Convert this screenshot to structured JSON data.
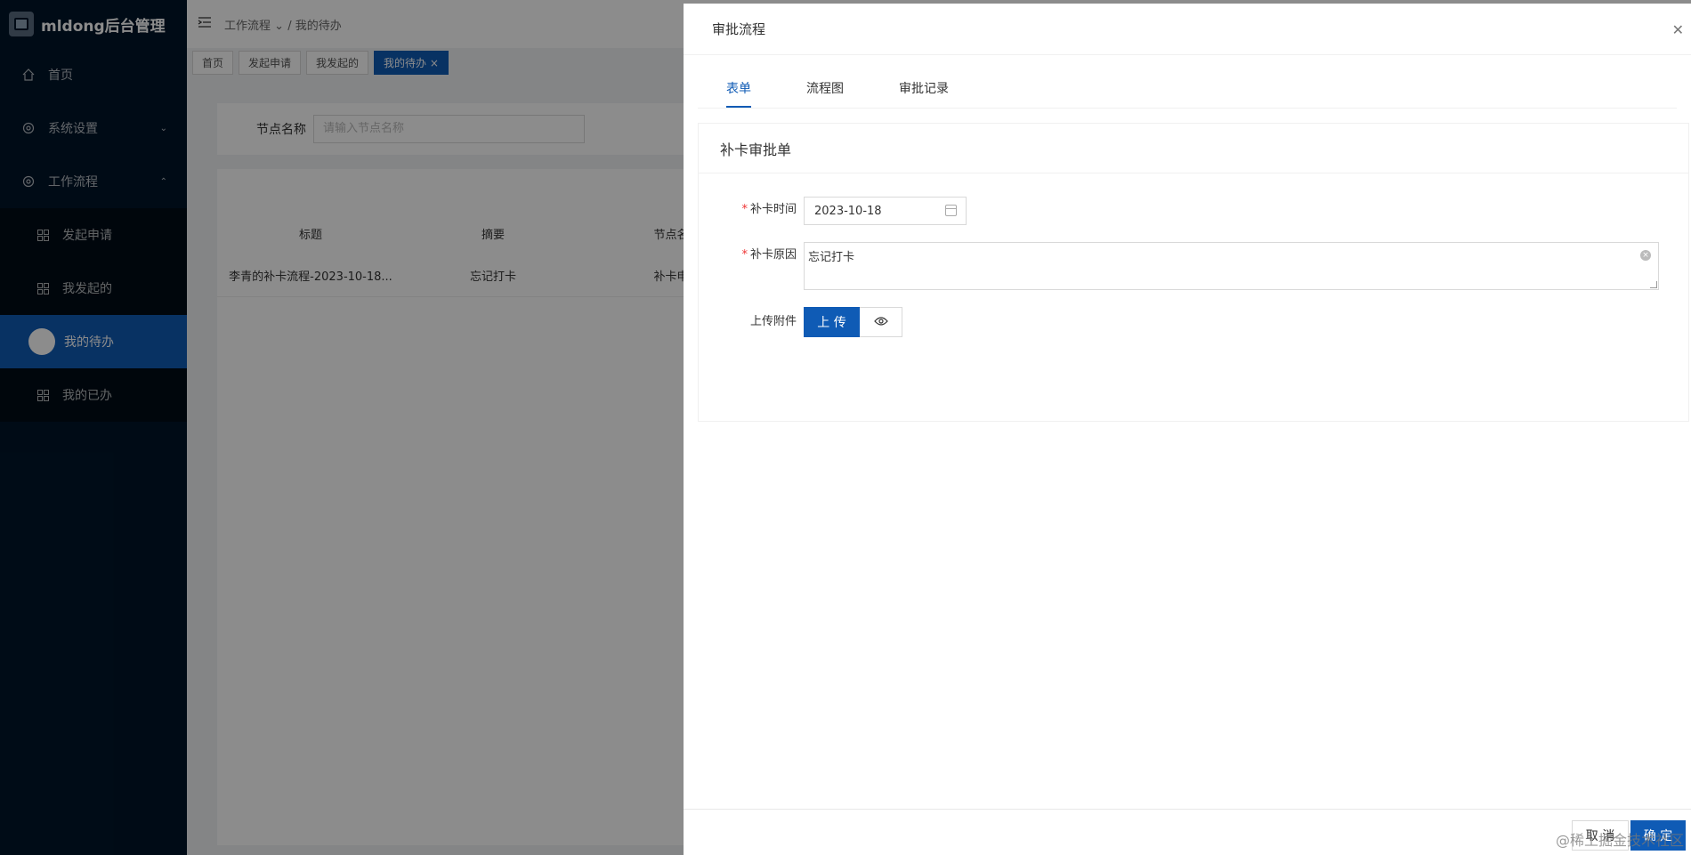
{
  "app": {
    "title": "mldong后台管理"
  },
  "sidebar": {
    "items": [
      {
        "label": "首页",
        "icon": "home-icon"
      },
      {
        "label": "系统设置",
        "icon": "gear-icon"
      },
      {
        "label": "工作流程",
        "icon": "gear-icon"
      }
    ],
    "subitems": [
      {
        "label": "发起申请",
        "icon": "grid-icon"
      },
      {
        "label": "我发起的",
        "icon": "grid-icon"
      },
      {
        "label": "我的待办",
        "icon": "circle-icon"
      },
      {
        "label": "我的已办",
        "icon": "grid-icon"
      }
    ]
  },
  "breadcrumb": {
    "parent": "工作流程",
    "current": "我的待办"
  },
  "tabs": [
    "首页",
    "发起申请",
    "我发起的",
    "我的待办"
  ],
  "search": {
    "label": "节点名称",
    "placeholder": "请输入节点名称"
  },
  "table": {
    "columns": [
      "标题",
      "摘要",
      "节点名"
    ],
    "rows": [
      [
        "李青的补卡流程-2023-10-18...",
        "忘记打卡",
        "补卡申"
      ]
    ]
  },
  "drawer": {
    "title": "审批流程",
    "tabs": [
      "表单",
      "流程图",
      "审批记录"
    ],
    "form_title": "补卡审批单",
    "fields": {
      "time_label": "补卡时间",
      "time_value": "2023-10-18",
      "reason_label": "补卡原因",
      "reason_value": "忘记打卡",
      "attach_label": "上传附件",
      "upload_label": "上 传"
    },
    "cancel_label": "取 消",
    "ok_label": "确 定",
    "watermark": "@稀土掘金技术社区"
  },
  "colors": {
    "primary": "#0f5bb5",
    "sidebar": "#001529"
  }
}
